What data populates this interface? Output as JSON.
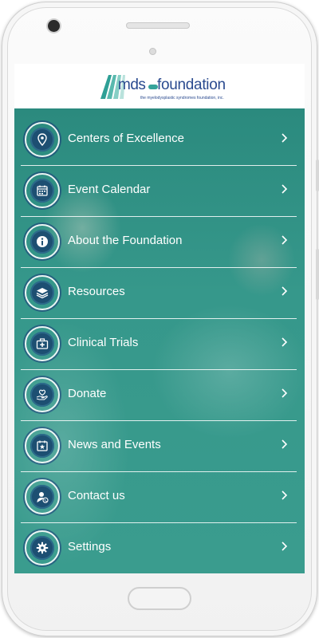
{
  "app": {
    "logo": {
      "brand_left": "mds",
      "brand_right": "foundation",
      "tagline": "the myelodysplastic syndromes foundation, inc."
    }
  },
  "menu": {
    "items": [
      {
        "label": "Centers of Excellence",
        "icon": "location-pin-icon"
      },
      {
        "label": "Event Calendar",
        "icon": "calendar-icon"
      },
      {
        "label": "About the Foundation",
        "icon": "info-icon"
      },
      {
        "label": "Resources",
        "icon": "layers-icon"
      },
      {
        "label": "Clinical Trials",
        "icon": "medical-kit-icon"
      },
      {
        "label": "Donate",
        "icon": "heart-hand-icon"
      },
      {
        "label": "News and Events",
        "icon": "calendar-star-icon"
      },
      {
        "label": "Contact us",
        "icon": "contact-person-icon"
      },
      {
        "label": "Settings",
        "icon": "gear-icon"
      }
    ]
  },
  "colors": {
    "accent_teal": "#2e8d80",
    "icon_navy": "#1d4f72",
    "brand_blue": "#2a4a8f"
  }
}
